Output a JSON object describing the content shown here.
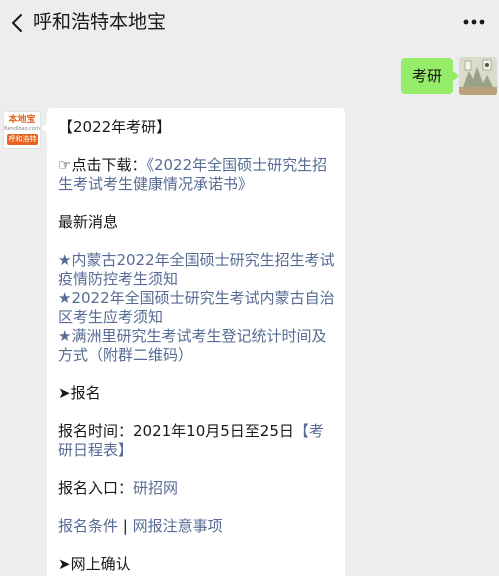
{
  "header": {
    "title": "呼和浩特本地宝"
  },
  "outgoing": {
    "message": "考研"
  },
  "incoming": {
    "logo": {
      "top": "本地宝",
      "mid": "Bendibao.com",
      "bottom": "呼和浩特"
    },
    "heading": "【2022年考研】",
    "download": {
      "prefix": "☞点击下载：",
      "link": "《2022年全国硕士研究生招生考试考生健康情况承诺书》"
    },
    "latest_news_label": "最新消息",
    "news": [
      "★内蒙古2022年全国硕士研究生招生考试疫情防控考生须知",
      "★2022年全国硕士研究生考试内蒙古自治区考生应考须知",
      "★满洲里研究生考试考生登记统计时间及方式（附群二维码）"
    ],
    "signup_section": "➤报名",
    "signup_time_prefix": "报名时间：2021年10月5日至25日",
    "signup_time_link": "【考研日程表】",
    "signup_entry_prefix": "报名入口：",
    "signup_entry_link": "研招网",
    "conditions_link": "报名条件",
    "separator": " | ",
    "notes_link": "网报注意事项",
    "confirm_section": "➤网上确认"
  },
  "colors": {
    "background": "#ededed",
    "bubble_green": "#95ec69",
    "link": "#576b95"
  }
}
